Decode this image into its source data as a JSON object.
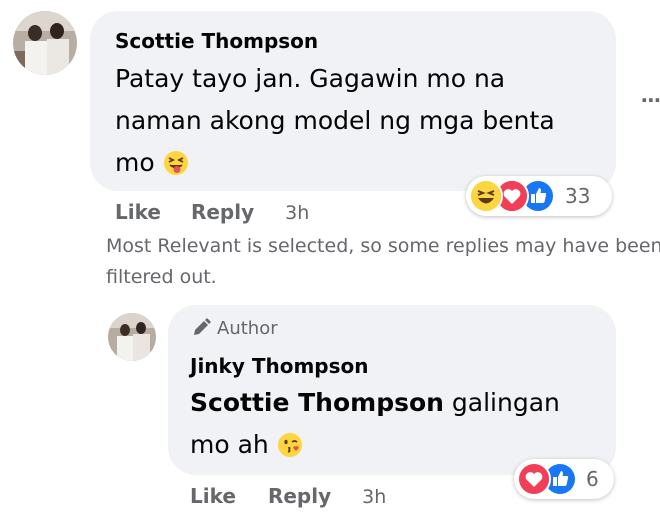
{
  "comment": {
    "author": "Scottie Thompson",
    "text": "Patay tayo jan. Gagawin mo na naman akong model ng mga benta mo",
    "emoji_icon": "squinting-tongue-emoji-icon",
    "reaction_icons": [
      "haha-icon",
      "love-icon",
      "like-icon"
    ],
    "reaction_count": "33",
    "like_label": "Like",
    "reply_label": "Reply",
    "time": "3h",
    "more_icon": "more-options-icon"
  },
  "filter_notice": "Most Relevant is selected, so some replies may have been filtered out.",
  "reply": {
    "badge_icon": "pencil-icon",
    "badge_label": "Author",
    "author": "Jinky Thompson",
    "mention": "Scottie Thompson",
    "text": " galingan mo ah",
    "emoji_icon": "kiss-emoji-icon",
    "reaction_icons": [
      "love-icon",
      "like-icon"
    ],
    "reaction_count": "6",
    "like_label": "Like",
    "reply_label": "Reply",
    "time": "3h"
  },
  "colors": {
    "bubble": "#f0f2f5",
    "secondary_text": "#65676b",
    "like_blue": "#1877f2",
    "love_red": "#f33e58",
    "haha_yellow": "#fcd53f"
  }
}
